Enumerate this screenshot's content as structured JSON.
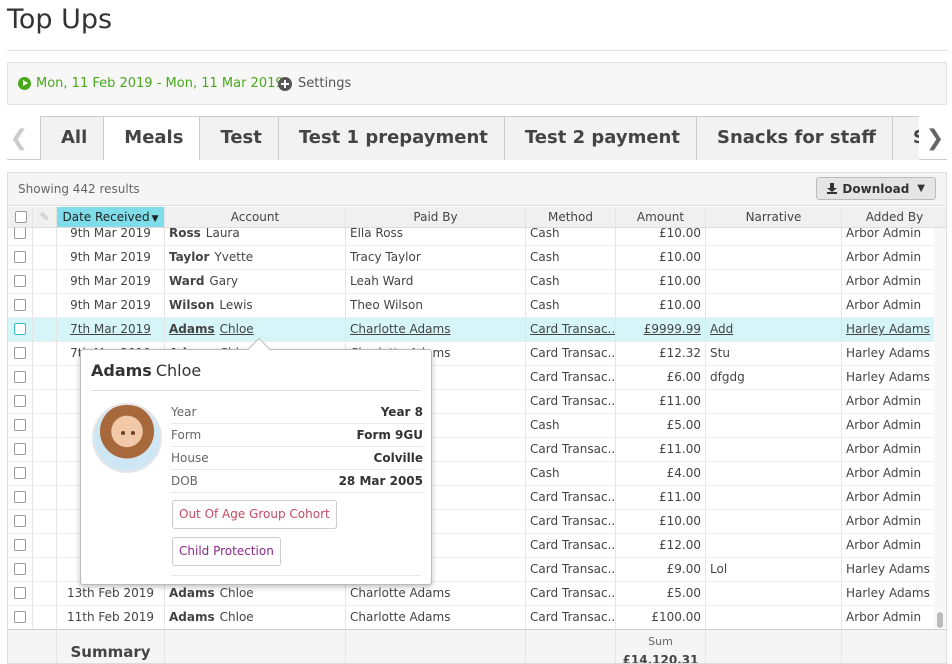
{
  "page": {
    "title": "Top Ups"
  },
  "filter": {
    "date_range": "Mon, 11 Feb 2019 - Mon, 11 Mar 2019",
    "settings_label": "Settings",
    "date_color": "#4aa81c"
  },
  "tabs": [
    {
      "label": "All",
      "active": false
    },
    {
      "label": "Meals",
      "active": true
    },
    {
      "label": "Test",
      "active": false
    },
    {
      "label": "Test 1 prepayment",
      "active": false
    },
    {
      "label": "Test 2 payment",
      "active": false
    },
    {
      "label": "Snacks for staff",
      "active": false
    },
    {
      "label": "Snacks f",
      "active": false
    }
  ],
  "grid": {
    "showing": "Showing 442 results",
    "download_label": "Download",
    "columns": {
      "date": "Date Received",
      "account": "Account",
      "paid_by": "Paid By",
      "method": "Method",
      "amount": "Amount",
      "narrative": "Narrative",
      "added_by": "Added By"
    },
    "sort_indicator": "▼",
    "sorted_color": "#7fdde9",
    "rows": [
      {
        "date": "9th Mar 2019",
        "last": "Ross",
        "first": "Laura",
        "paid_by": "Ella Ross",
        "method": "Cash",
        "amount": "£10.00",
        "narrative": "",
        "added_by": "Arbor Admin"
      },
      {
        "date": "9th Mar 2019",
        "last": "Taylor",
        "first": "Yvette",
        "paid_by": "Tracy Taylor",
        "method": "Cash",
        "amount": "£10.00",
        "narrative": "",
        "added_by": "Arbor Admin"
      },
      {
        "date": "9th Mar 2019",
        "last": "Ward",
        "first": "Gary",
        "paid_by": "Leah Ward",
        "method": "Cash",
        "amount": "£10.00",
        "narrative": "",
        "added_by": "Arbor Admin"
      },
      {
        "date": "9th Mar 2019",
        "last": "Wilson",
        "first": "Lewis",
        "paid_by": "Theo Wilson",
        "method": "Cash",
        "amount": "£10.00",
        "narrative": "",
        "added_by": "Arbor Admin"
      },
      {
        "date": "7th Mar 2019",
        "last": "Adams",
        "first": "Chloe",
        "paid_by": "Charlotte Adams",
        "method": "Card Transac...",
        "amount": "£9999.99",
        "narrative": "Add",
        "added_by": "Harley Adams"
      },
      {
        "date": "7th Mar 2019",
        "last": "Adams",
        "first": "Chloe",
        "paid_by": "Charlotte Adams",
        "method": "Card Transac...",
        "amount": "£12.32",
        "narrative": "Stu",
        "added_by": "Harley Adams"
      },
      {
        "date": "7",
        "last": "",
        "first": "",
        "paid_by": "ns",
        "method": "Card Transac...",
        "amount": "£6.00",
        "narrative": "dfgdg",
        "added_by": "Harley Adams"
      },
      {
        "date": "7",
        "last": "",
        "first": "",
        "paid_by": "ns",
        "method": "Card Transac...",
        "amount": "£11.00",
        "narrative": "",
        "added_by": "Arbor Admin"
      },
      {
        "date": "6",
        "last": "",
        "first": "",
        "paid_by": "ns",
        "method": "Cash",
        "amount": "£5.00",
        "narrative": "",
        "added_by": "Arbor Admin"
      },
      {
        "date": "6",
        "last": "",
        "first": "",
        "paid_by": "ns",
        "method": "Card Transac...",
        "amount": "£11.00",
        "narrative": "",
        "added_by": "Arbor Admin"
      },
      {
        "date": "5",
        "last": "",
        "first": "",
        "paid_by": "ns",
        "method": "Cash",
        "amount": "£4.00",
        "narrative": "",
        "added_by": "Arbor Admin"
      },
      {
        "date": "25",
        "last": "",
        "first": "",
        "paid_by": "ns",
        "method": "Card Transac...",
        "amount": "£11.00",
        "narrative": "",
        "added_by": "Arbor Admin"
      },
      {
        "date": "22",
        "last": "",
        "first": "",
        "paid_by": "ns",
        "method": "Card Transac...",
        "amount": "£10.00",
        "narrative": "",
        "added_by": "Arbor Admin"
      },
      {
        "date": "15",
        "last": "",
        "first": "",
        "paid_by": "ns",
        "method": "Card Transac...",
        "amount": "£12.00",
        "narrative": "",
        "added_by": "Arbor Admin"
      },
      {
        "date": "13",
        "last": "",
        "first": "",
        "paid_by": "ns",
        "method": "Card Transac...",
        "amount": "£9.00",
        "narrative": "Lol",
        "added_by": "Harley Adams"
      },
      {
        "date": "13th Feb 2019",
        "last": "Adams",
        "first": "Chloe",
        "paid_by": "Charlotte Adams",
        "method": "Card Transac...",
        "amount": "£5.00",
        "narrative": "",
        "added_by": "Harley Adams"
      },
      {
        "date": "11th Feb 2019",
        "last": "Adams",
        "first": "Chloe",
        "paid_by": "Charlotte Adams",
        "method": "Card Transac...",
        "amount": "£100.00",
        "narrative": "",
        "added_by": "Arbor Admin"
      }
    ],
    "highlight_row": 4,
    "summary": {
      "label": "Summary",
      "sum_label": "Sum",
      "sum_value": "£14,120.31"
    }
  },
  "popup": {
    "last": "Adams",
    "first": "Chloe",
    "fields": [
      {
        "key": "Year",
        "value": "Year 8"
      },
      {
        "key": "Form",
        "value": "Form 9GU"
      },
      {
        "key": "House",
        "value": "Colville"
      },
      {
        "key": "DOB",
        "value": "28 Mar 2005"
      }
    ],
    "badges": [
      {
        "label": "Out Of Age Group Cohort",
        "color": "#c44a64"
      },
      {
        "label": "Child Protection",
        "color": "#8a2a8a"
      }
    ]
  }
}
